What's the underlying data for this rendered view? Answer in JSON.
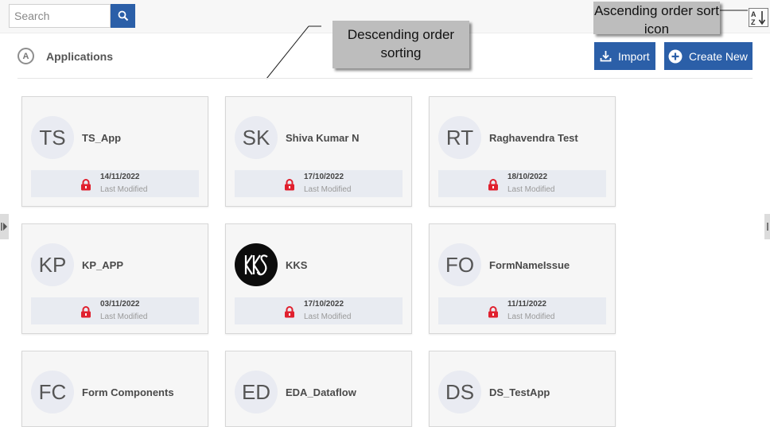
{
  "search": {
    "placeholder": "Search"
  },
  "header": {
    "title": "Applications",
    "icon_letter": "A"
  },
  "toolbar": {
    "import_label": "Import",
    "create_label": "Create New"
  },
  "callouts": {
    "ascending": "Ascending order sort icon",
    "descending": "Descending order sorting"
  },
  "colors": {
    "accent": "#2b5fa8",
    "lock": "#e0202e",
    "callout_bg": "#bdbdbd"
  },
  "icons": {
    "search": "search-icon",
    "sort": "sort-az-icon",
    "import": "download-icon",
    "create": "plus-circle-icon",
    "lock": "lock-icon"
  },
  "footer_label": "Last Modified",
  "apps": [
    {
      "initials": "TS",
      "name": "TS_App",
      "date": "14/11/2022"
    },
    {
      "initials": "SK",
      "name": "Shiva Kumar N",
      "date": "17/10/2022"
    },
    {
      "initials": "RT",
      "name": "Raghavendra Test",
      "date": "18/10/2022"
    },
    {
      "initials": "KP",
      "name": "KP_APP",
      "date": "03/11/2022"
    },
    {
      "initials": "",
      "name": "KKS",
      "date": "17/10/2022",
      "logo": true
    },
    {
      "initials": "FO",
      "name": "FormNameIssue",
      "date": "11/11/2022"
    },
    {
      "initials": "FC",
      "name": "Form Components",
      "date": ""
    },
    {
      "initials": "ED",
      "name": "EDA_Dataflow",
      "date": ""
    },
    {
      "initials": "DS",
      "name": "DS_TestApp",
      "date": ""
    }
  ]
}
